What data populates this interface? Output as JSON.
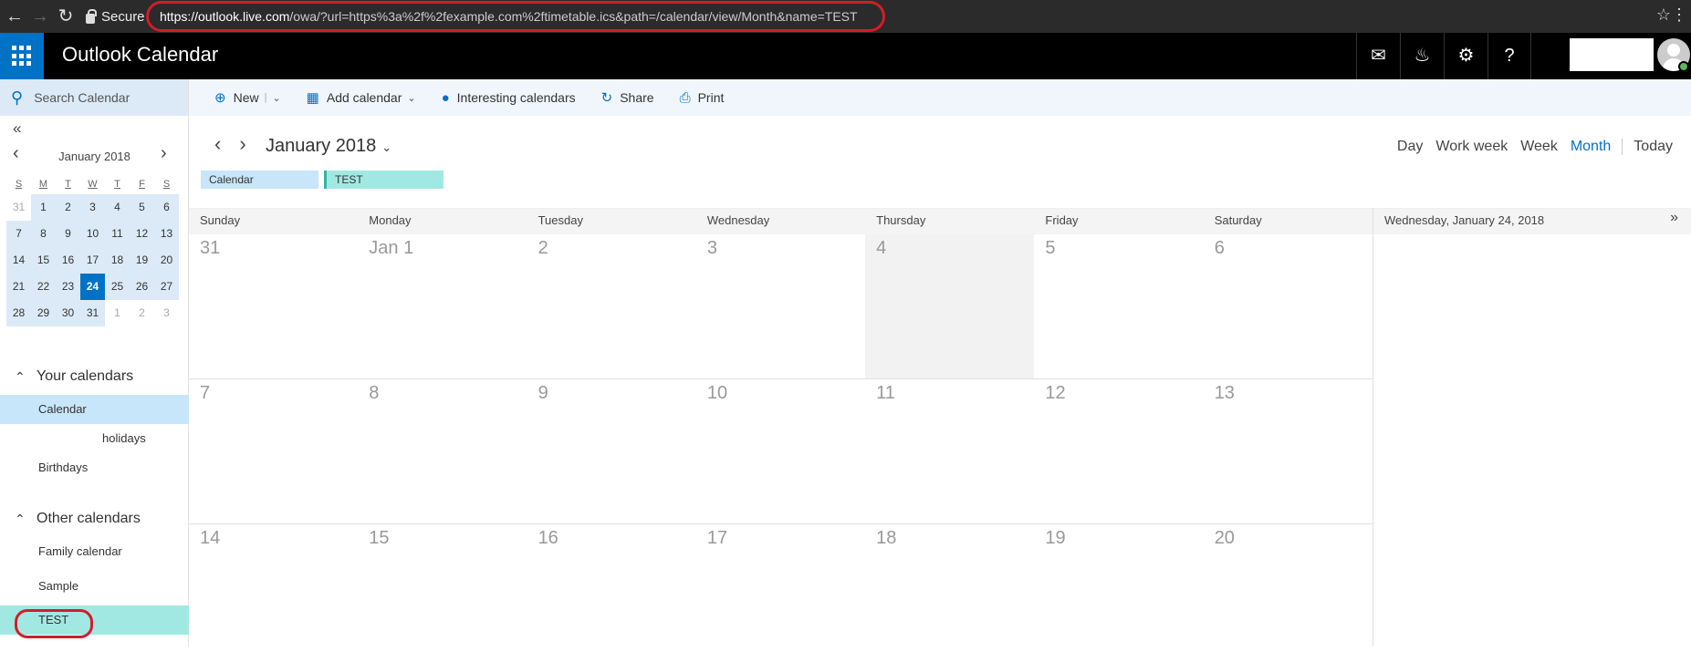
{
  "browser": {
    "secure_label": "Secure",
    "url_host": "https://outlook.live.com",
    "url_rest": "/owa/?url=https%3a%2f%2fexample.com%2ftimetable.ics&path=/calendar/view/Month&name=TEST"
  },
  "app": {
    "title": "Outlook Calendar",
    "header_icons": [
      "chat-icon",
      "bell-icon",
      "gear-icon",
      "help-icon"
    ]
  },
  "search": {
    "placeholder": "Search Calendar"
  },
  "mini_calendar": {
    "month_label": "January 2018",
    "weekday_letters": [
      "S",
      "M",
      "T",
      "W",
      "T",
      "F",
      "S"
    ],
    "weeks": [
      [
        "31",
        "1",
        "2",
        "3",
        "4",
        "5",
        "6"
      ],
      [
        "7",
        "8",
        "9",
        "10",
        "11",
        "12",
        "13"
      ],
      [
        "14",
        "15",
        "16",
        "17",
        "18",
        "19",
        "20"
      ],
      [
        "21",
        "22",
        "23",
        "24",
        "25",
        "26",
        "27"
      ],
      [
        "28",
        "29",
        "30",
        "31",
        "1",
        "2",
        "3"
      ]
    ],
    "selected_day": "24"
  },
  "your_calendars": {
    "title": "Your calendars",
    "items": [
      "Calendar",
      "holidays",
      "Birthdays"
    ]
  },
  "other_calendars": {
    "title": "Other calendars",
    "items": [
      "Family calendar",
      "Sample",
      "TEST"
    ]
  },
  "toolbar": {
    "new": "New",
    "add_calendar": "Add calendar",
    "interesting": "Interesting calendars",
    "share": "Share",
    "print": "Print"
  },
  "calendar_header": {
    "month": "January 2018",
    "views": [
      "Day",
      "Work week",
      "Week",
      "Month"
    ],
    "active_view": "Month",
    "today": "Today",
    "chips": [
      "Calendar",
      "TEST"
    ]
  },
  "month_grid": {
    "day_names": [
      "Sunday",
      "Monday",
      "Tuesday",
      "Wednesday",
      "Thursday",
      "Friday",
      "Saturday"
    ],
    "weeks": [
      [
        "31",
        "Jan 1",
        "2",
        "3",
        "4",
        "5",
        "6"
      ],
      [
        "7",
        "8",
        "9",
        "10",
        "11",
        "12",
        "13"
      ],
      [
        "14",
        "15",
        "16",
        "17",
        "18",
        "19",
        "20"
      ]
    ]
  },
  "right_pane": {
    "date": "Wednesday, January 24, 2018"
  },
  "colors": {
    "accent": "#0072c6",
    "test_calendar": "#a2e8e2",
    "calendar": "#c7e6f9",
    "annotation": "#d01e2a"
  }
}
